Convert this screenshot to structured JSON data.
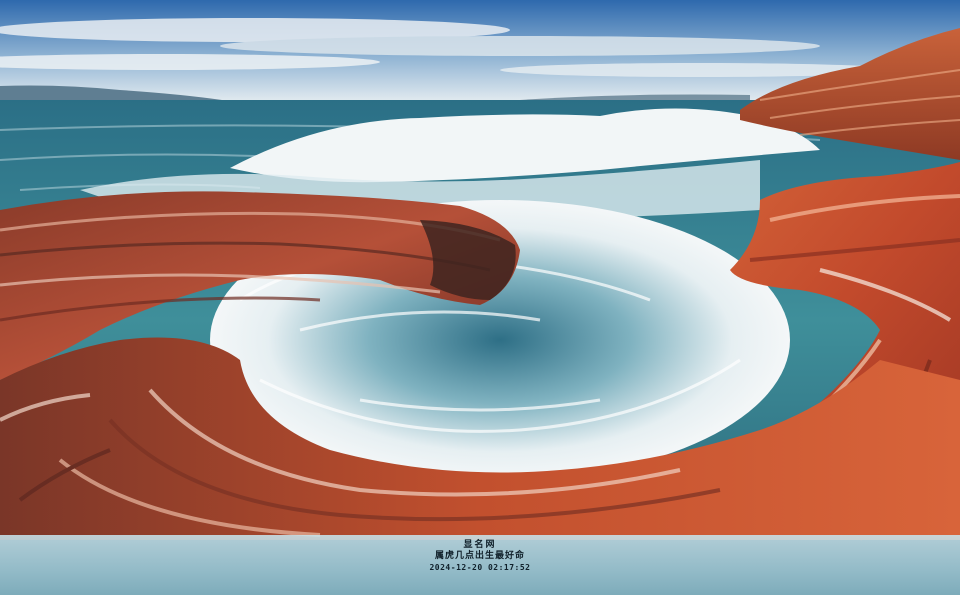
{
  "photo": {
    "subject": "",
    "colors": {
      "sky_top": "#2f6fb0",
      "sky_horizon": "#dfe8ee",
      "sea_deep": "#1f5a6e",
      "sea_teal": "#3e8a96",
      "foam": "#eef4f6",
      "rock_red": "#b8432a",
      "rock_orange": "#d9643a",
      "rock_dark": "#5a2a22",
      "rock_pale": "#e8c9b8"
    }
  },
  "caption": {
    "title": "显名网",
    "subtitle": "属虎几点出生最好命",
    "timestamp": "2024-12-20 02:17:52"
  }
}
